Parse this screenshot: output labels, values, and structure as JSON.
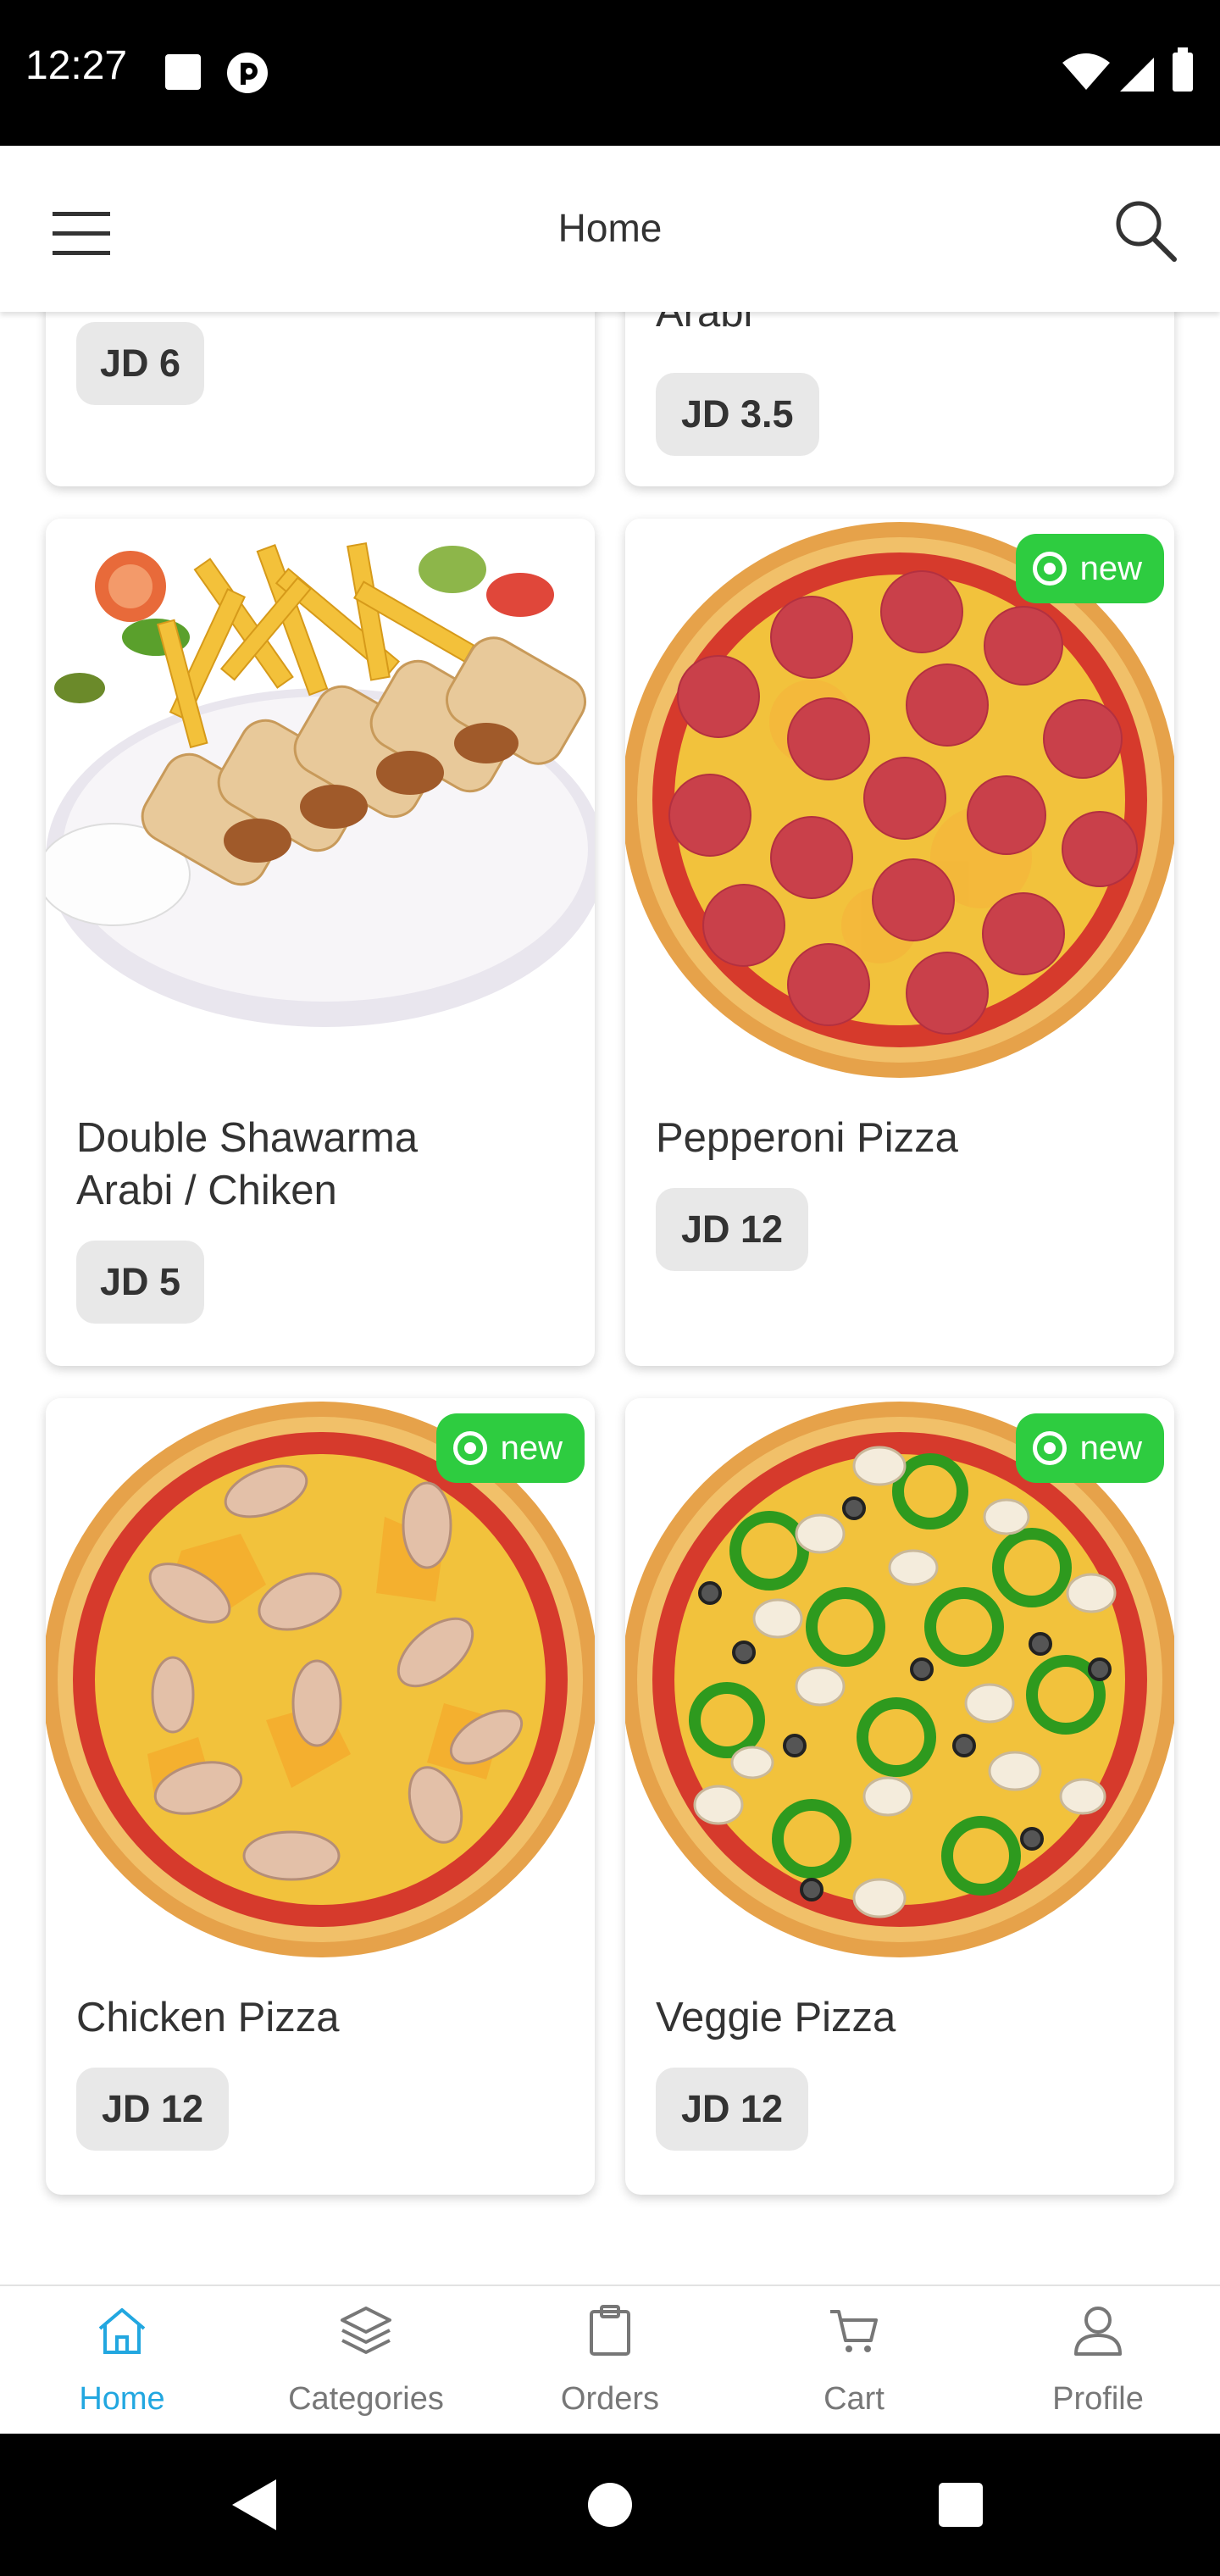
{
  "status_bar": {
    "time": "12:27"
  },
  "app_bar": {
    "title": "Home"
  },
  "cards": [
    {
      "id": "partial-left",
      "price": "JD 6"
    },
    {
      "id": "partial-right",
      "name_fragment": "Arabi",
      "price": "JD 3.5"
    },
    {
      "id": "double-shawarma",
      "name_line1": "Double Shawarma",
      "name_line2": "Arabi / Chiken",
      "price": "JD 5",
      "is_new": false
    },
    {
      "id": "pepperoni",
      "name": "Pepperoni Pizza",
      "price": "JD 12",
      "is_new": true,
      "badge": "new"
    },
    {
      "id": "chicken",
      "name": "Chicken Pizza",
      "price": "JD 12",
      "is_new": true,
      "badge": "new"
    },
    {
      "id": "veggie",
      "name": "Veggie Pizza",
      "price": "JD 12",
      "is_new": true,
      "badge": "new"
    }
  ],
  "bottom_nav": {
    "items": [
      {
        "label": "Home",
        "icon": "home-icon",
        "active": true
      },
      {
        "label": "Categories",
        "icon": "layers-icon",
        "active": false
      },
      {
        "label": "Orders",
        "icon": "clipboard-icon",
        "active": false
      },
      {
        "label": "Cart",
        "icon": "cart-icon",
        "active": false
      },
      {
        "label": "Profile",
        "icon": "user-icon",
        "active": false
      }
    ]
  },
  "colors": {
    "accent": "#22a7e0",
    "new_badge": "#2ecc40",
    "price_pill": "#e8e8e8"
  }
}
